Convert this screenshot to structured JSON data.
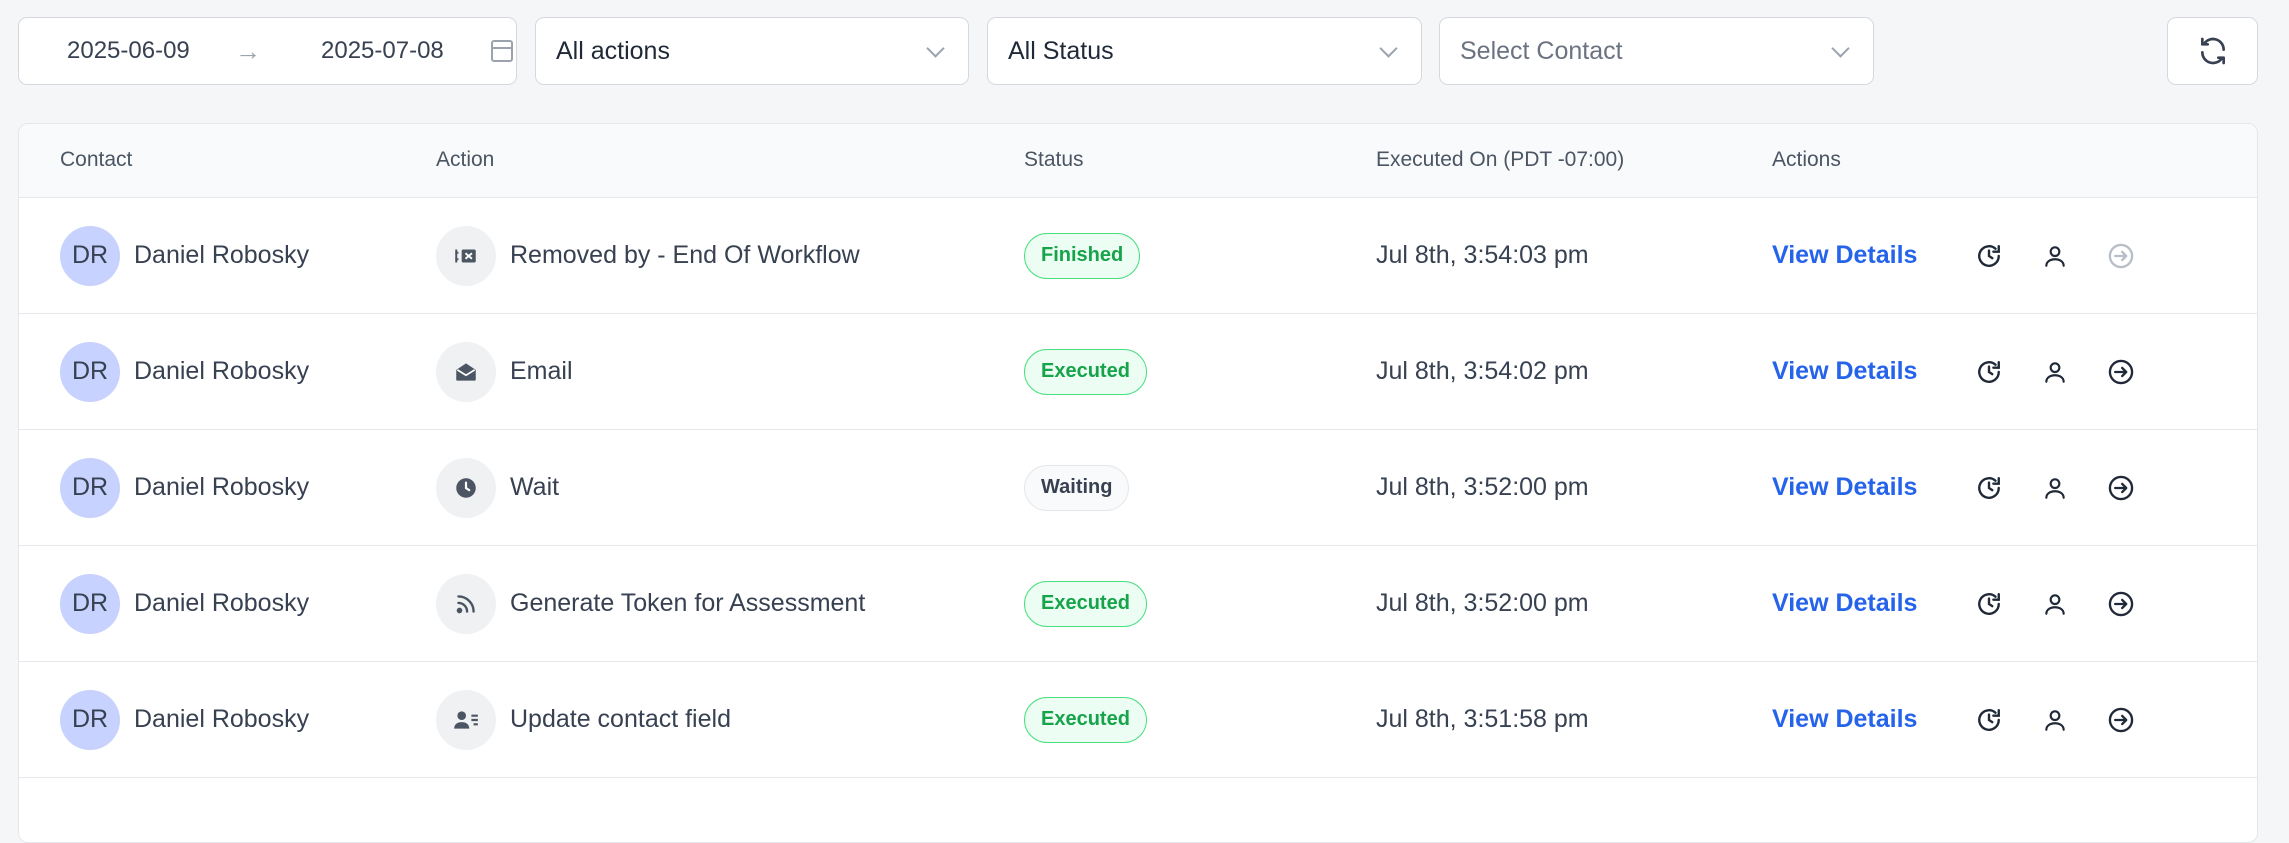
{
  "filters": {
    "date_start": "2025-06-09",
    "date_end": "2025-07-08",
    "actions_select": "All actions",
    "status_select": "All Status",
    "contact_placeholder": "Select Contact"
  },
  "table": {
    "headers": {
      "contact": "Contact",
      "action": "Action",
      "status": "Status",
      "executed_on": "Executed On (PDT -07:00)",
      "actions": "Actions"
    },
    "rows": [
      {
        "initials": "DR",
        "contact": "Daniel Robosky",
        "action": "Removed by - End Of Workflow",
        "action_icon": "remove-workflow-icon",
        "status": "Finished",
        "executed": "Jul 8th, 3:54:03 pm",
        "view": "View Details"
      },
      {
        "initials": "DR",
        "contact": "Daniel Robosky",
        "action": "Email",
        "action_icon": "email-icon",
        "status": "Executed",
        "executed": "Jul 8th, 3:54:02 pm",
        "view": "View Details"
      },
      {
        "initials": "DR",
        "contact": "Daniel Robosky",
        "action": "Wait",
        "action_icon": "clock-icon",
        "status": "Waiting",
        "executed": "Jul 8th, 3:52:00 pm",
        "view": "View Details"
      },
      {
        "initials": "DR",
        "contact": "Daniel Robosky",
        "action": "Generate Token for Assessment",
        "action_icon": "webhook-icon",
        "status": "Executed",
        "executed": "Jul 8th, 3:52:00 pm",
        "view": "View Details"
      },
      {
        "initials": "DR",
        "contact": "Daniel Robosky",
        "action": "Update contact field",
        "action_icon": "contact-card-icon",
        "status": "Executed",
        "executed": "Jul 8th, 3:51:58 pm",
        "view": "View Details"
      }
    ]
  },
  "colors": {
    "accent": "#2563eb",
    "status_green": "#16a34a",
    "avatar_bg": "#c7d2fe"
  }
}
